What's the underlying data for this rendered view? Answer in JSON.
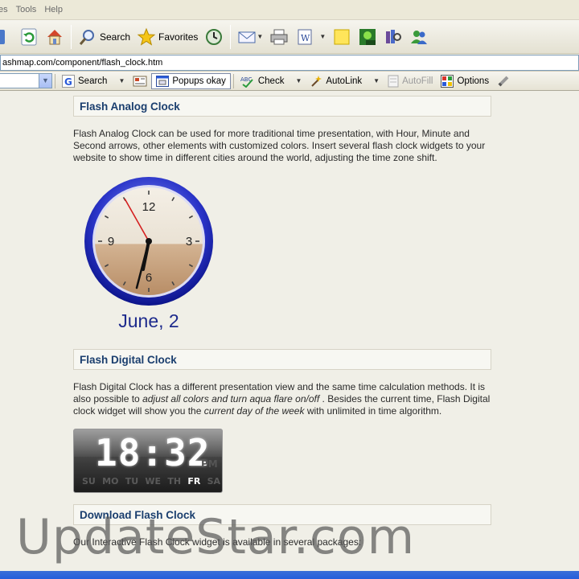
{
  "menu": {
    "items": [
      "es",
      "Tools",
      "Help"
    ]
  },
  "toolbar": {
    "search_label": "Search",
    "favorites_label": "Favorites"
  },
  "address": {
    "value": "ashmap.com/component/flash_clock.htm"
  },
  "google_toolbar": {
    "search_label": "Search",
    "popups_label": "Popups okay",
    "check_label": "Check",
    "autolink_label": "AutoLink",
    "autofill_label": "AutoFill",
    "options_label": "Options"
  },
  "page": {
    "analog": {
      "title": "Flash Analog Clock",
      "description": "Flash Analog Clock can be used for more traditional time presentation, with Hour, Minute and Second arrows, other elements with customized colors. Insert several flash clock widgets to your website to show time in different cities around the world, adjusting the time zone shift.",
      "numerals": [
        "12",
        "3",
        "6",
        "9"
      ],
      "date": "June, 2"
    },
    "digital": {
      "title": "Flash Digital Clock",
      "desc_part1": "Flash Digital Clock has a different presentation view and the same time calculation methods. It is also possible to ",
      "desc_em1": "adjust all colors and turn aqua flare on/off",
      "desc_part2": " . Besides the current time, Flash Digital clock widget will show you the ",
      "desc_em2": "current day of the week",
      "desc_part3": " with unlimited in time algorithm.",
      "time": "18:32",
      "pm": "PM",
      "days": [
        "SU",
        "MO",
        "TU",
        "WE",
        "TH",
        "FR",
        "SA"
      ],
      "active_day": "FR"
    },
    "download": {
      "title": "Download Flash Clock",
      "description": "Our Interactive Flash Clock widget is available in several packages:"
    }
  },
  "watermark": "UpdateStar.com"
}
